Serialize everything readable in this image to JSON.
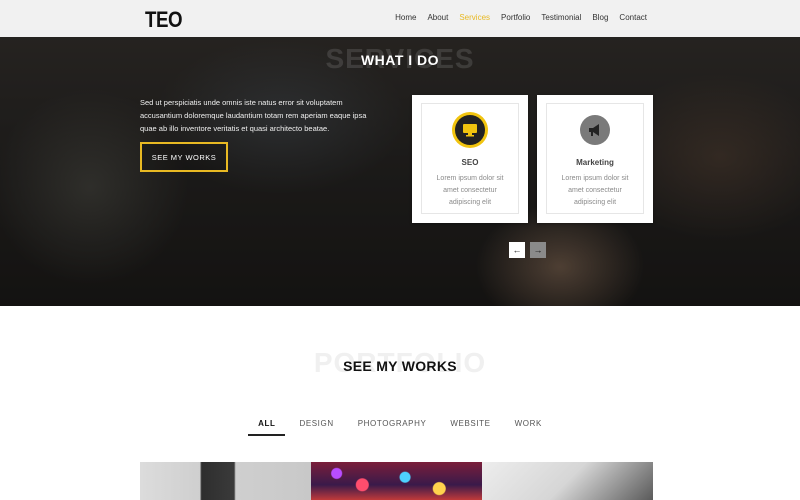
{
  "header": {
    "logo": "TEO",
    "nav": [
      {
        "label": "Home",
        "active": false
      },
      {
        "label": "About",
        "active": false
      },
      {
        "label": "Services",
        "active": true
      },
      {
        "label": "Portfolio",
        "active": false
      },
      {
        "label": "Testimonial",
        "active": false
      },
      {
        "label": "Blog",
        "active": false
      },
      {
        "label": "Contact",
        "active": false
      }
    ]
  },
  "services": {
    "ghost_title": "SERVICES",
    "title": "WHAT I DO",
    "text": "Sed ut perspiciatis unde omnis iste natus error sit voluptatem accusantium doloremque laudantium totam rem aperiam eaque ipsa quae ab illo inventore veritatis et quasi architecto beatae.",
    "button": "SEE MY WORKS",
    "cards": [
      {
        "icon": "monitor-icon",
        "title": "SEO",
        "text": "Lorem ipsum dolor sit amet consectetur adipiscing elit",
        "icon_bg": "#222222",
        "ring": "#f1c40f"
      },
      {
        "icon": "megaphone-icon",
        "title": "Marketing",
        "text": "Lorem ipsum dolor sit amet consectetur adipiscing elit",
        "icon_bg": "#7a7a7a",
        "ring": null
      }
    ]
  },
  "portfolio": {
    "ghost_title": "PORTFOLIO",
    "title": "SEE MY WORKS",
    "filters": [
      "ALL",
      "DESIGN",
      "PHOTOGRAPHY",
      "WEBSITE",
      "WORK"
    ],
    "active_filter": "ALL"
  },
  "colors": {
    "accent": "#e8b923",
    "dark": "#111111"
  }
}
